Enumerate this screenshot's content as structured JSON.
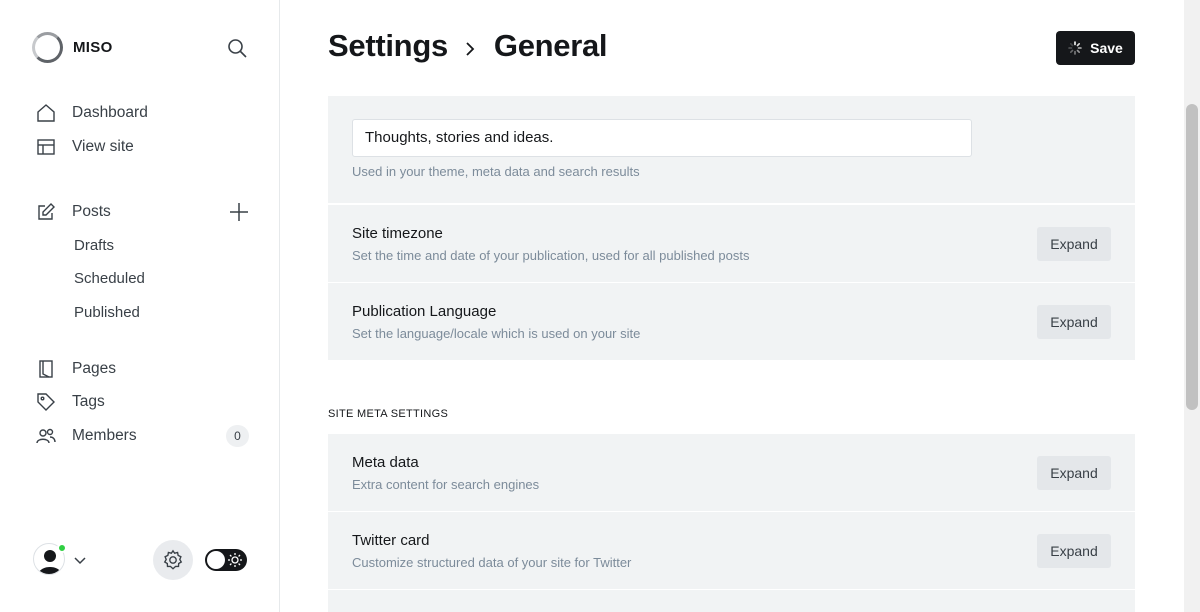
{
  "sidebar": {
    "brand": "MISO",
    "nav": {
      "dashboard": "Dashboard",
      "view_site": "View site",
      "posts": "Posts",
      "drafts": "Drafts",
      "scheduled": "Scheduled",
      "published": "Published",
      "pages": "Pages",
      "tags": "Tags",
      "members": "Members",
      "members_count": "0"
    }
  },
  "header": {
    "breadcrumb_parent": "Settings",
    "breadcrumb_current": "General",
    "save_label": "Save"
  },
  "description": {
    "value": "Thoughts, stories and ideas.",
    "hint": "Used in your theme, meta data and search results"
  },
  "rows": [
    {
      "title": "Site timezone",
      "desc": "Set the time and date of your publication, used for all published posts",
      "button": "Expand"
    },
    {
      "title": "Publication Language",
      "desc": "Set the language/locale which is used on your site",
      "button": "Expand"
    },
    {
      "title": "Meta data",
      "desc": "Extra content for search engines",
      "button": "Expand"
    },
    {
      "title": "Twitter card",
      "desc": "Customize structured data of your site for Twitter",
      "button": "Expand"
    }
  ],
  "section": {
    "meta_label": "SITE META SETTINGS"
  },
  "colors": {
    "accent": "#15171a",
    "panel_bg": "#f1f3f4",
    "status_online": "#30cf43"
  }
}
